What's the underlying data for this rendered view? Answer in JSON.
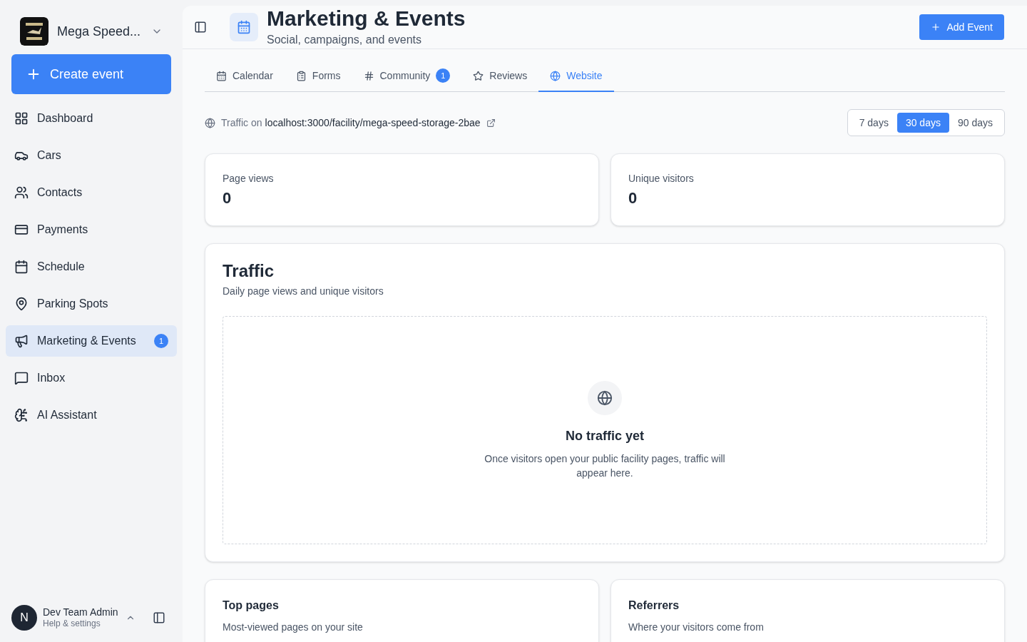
{
  "workspace": {
    "name": "Mega Speed..."
  },
  "create_button": "Create event",
  "nav": [
    {
      "label": "Dashboard",
      "selected": false
    },
    {
      "label": "Cars",
      "selected": false
    },
    {
      "label": "Contacts",
      "selected": false
    },
    {
      "label": "Payments",
      "selected": false
    },
    {
      "label": "Schedule",
      "selected": false
    },
    {
      "label": "Parking Spots",
      "selected": false
    },
    {
      "label": "Marketing & Events",
      "selected": true,
      "badge": "1"
    },
    {
      "label": "Inbox",
      "selected": false
    },
    {
      "label": "AI Assistant",
      "selected": false
    }
  ],
  "user": {
    "initial": "N",
    "name": "Dev Team Admin",
    "subtitle": "Help & settings"
  },
  "header": {
    "title": "Marketing & Events",
    "subtitle": "Social, campaigns, and events",
    "action": "Add Event"
  },
  "tabs": [
    {
      "label": "Calendar",
      "selected": false
    },
    {
      "label": "Forms",
      "selected": false
    },
    {
      "label": "Community",
      "selected": false,
      "badge": "1"
    },
    {
      "label": "Reviews",
      "selected": false
    },
    {
      "label": "Website",
      "selected": true
    }
  ],
  "traffic_source": {
    "prefix": "Traffic on",
    "url": "localhost:3000/facility/mega-speed-storage-2bae"
  },
  "ranges": [
    {
      "label": "7 days",
      "selected": false
    },
    {
      "label": "30 days",
      "selected": true
    },
    {
      "label": "90 days",
      "selected": false
    }
  ],
  "stats": [
    {
      "label": "Page views",
      "value": "0"
    },
    {
      "label": "Unique visitors",
      "value": "0"
    }
  ],
  "traffic": {
    "title": "Traffic",
    "subtitle": "Daily page views and unique visitors",
    "empty_title": "No traffic yet",
    "empty_text": "Once visitors open your public facility pages, traffic will appear here."
  },
  "bottom_cards": [
    {
      "title": "Top pages",
      "subtitle": "Most-viewed pages on your site"
    },
    {
      "title": "Referrers",
      "subtitle": "Where your visitors come from"
    }
  ]
}
